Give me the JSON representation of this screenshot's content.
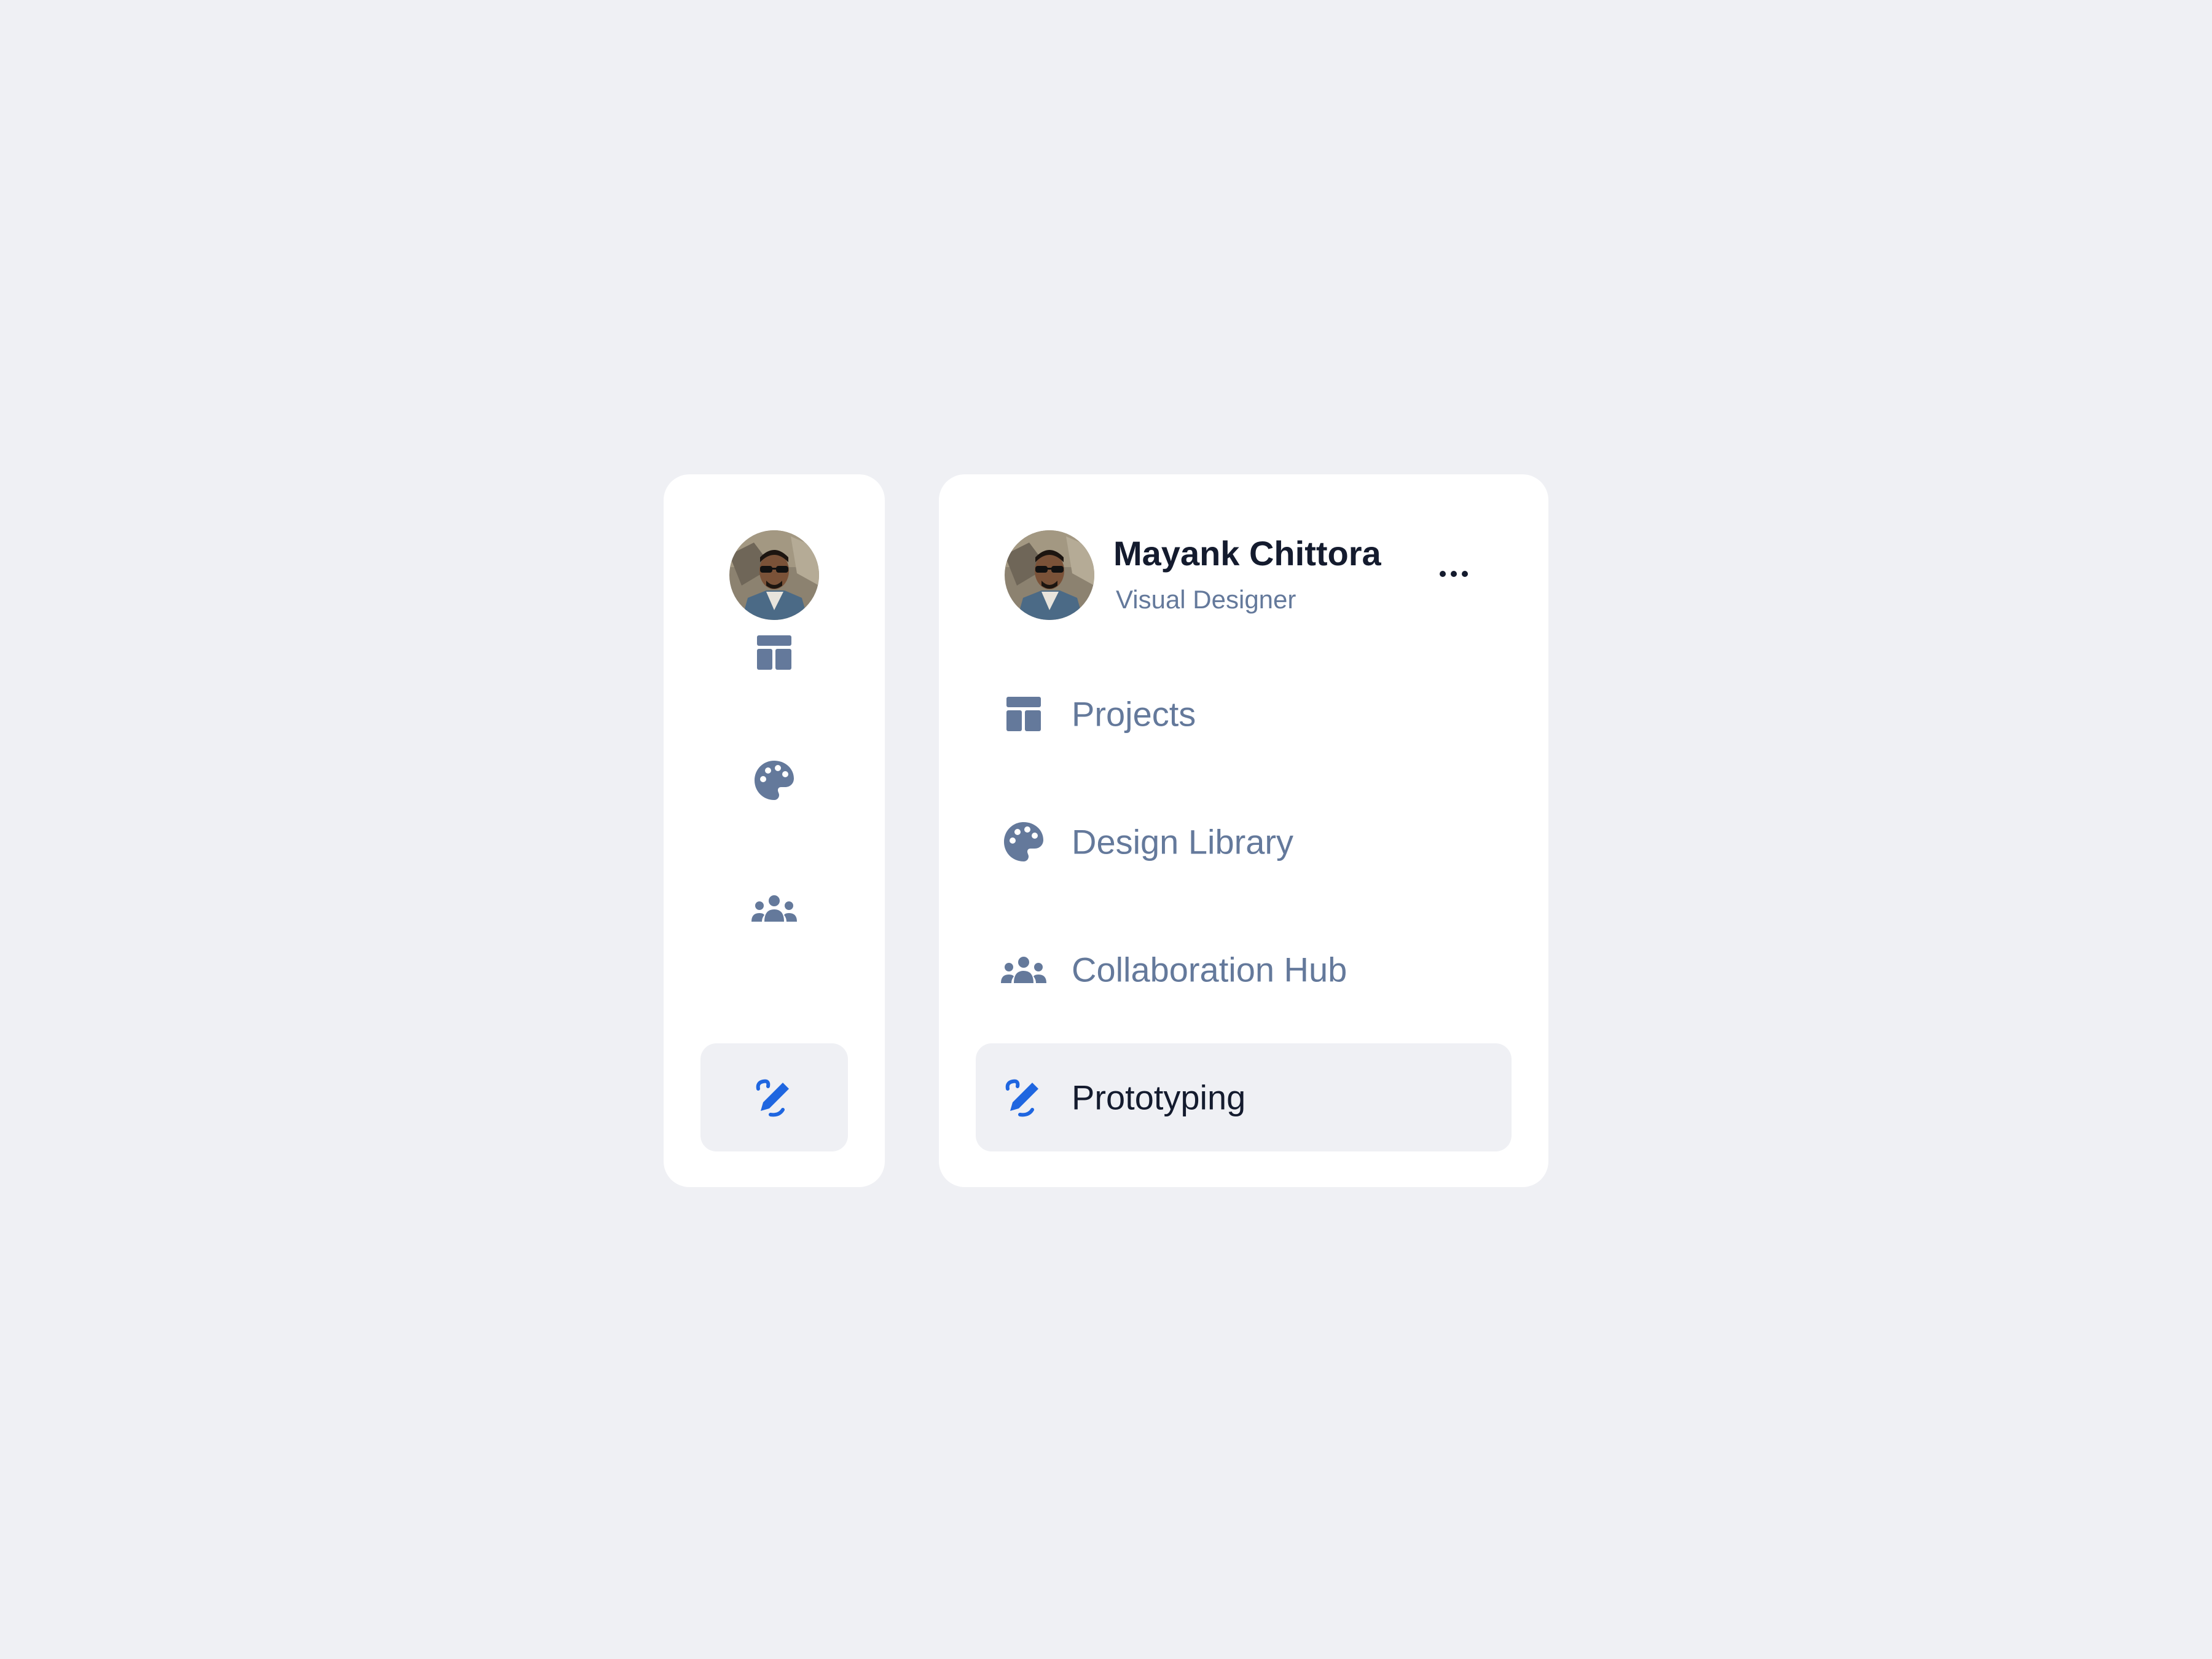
{
  "user": {
    "name": "Mayank Chittora",
    "role": "Visual Designer"
  },
  "menu": {
    "items": [
      {
        "label": "Projects",
        "icon": "dashboard-layout-icon",
        "active": false
      },
      {
        "label": "Design Library",
        "icon": "palette-icon",
        "active": false
      },
      {
        "label": "Collaboration Hub",
        "icon": "group-icon",
        "active": false
      },
      {
        "label": "Prototyping",
        "icon": "draw-pencil-icon",
        "active": true
      }
    ]
  },
  "colors": {
    "background": "#eff0f4",
    "panel": "#ffffff",
    "icon_default": "#64799b",
    "icon_active": "#1f66e0",
    "text_primary": "#141b2e",
    "text_secondary": "#64799b"
  }
}
